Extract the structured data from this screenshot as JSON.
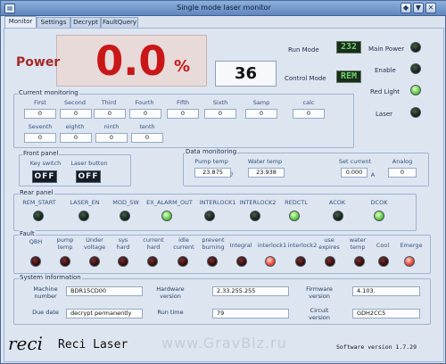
{
  "window": {
    "title": "Single mode laser monitor"
  },
  "tabs": [
    "Monitor",
    "Settings",
    "Decrypt",
    "FaultQuery"
  ],
  "power": {
    "label": "Power",
    "value": "0.0",
    "unit": "%"
  },
  "control": {
    "readout": "36",
    "run_mode_label": "Run Mode",
    "control_mode_label": "Control Mode",
    "run_mode_value": "232",
    "control_mode_value": "REM"
  },
  "status_leds": [
    {
      "label": "Main Power",
      "state": "off"
    },
    {
      "label": "Enable",
      "state": "off"
    },
    {
      "label": "Red Light",
      "state": "green"
    },
    {
      "label": "Laser",
      "state": "off"
    }
  ],
  "current_monitoring": {
    "title": "Current monitoring",
    "row1": [
      {
        "label": "First",
        "value": "0"
      },
      {
        "label": "Second",
        "value": "0"
      },
      {
        "label": "Third",
        "value": "0"
      },
      {
        "label": "Fourth",
        "value": "0"
      },
      {
        "label": "Fifth",
        "value": "0"
      },
      {
        "label": "Sixth",
        "value": "0"
      },
      {
        "label": "Samp",
        "value": "0"
      },
      {
        "label": "calc",
        "value": "0"
      }
    ],
    "row2": [
      {
        "label": "Seventh",
        "value": "0"
      },
      {
        "label": "eighth",
        "value": "0"
      },
      {
        "label": "ninth",
        "value": "0"
      },
      {
        "label": "tenth",
        "value": "0"
      }
    ]
  },
  "front_panel": {
    "title": "Front panel",
    "key_switch_label": "Key switch",
    "laser_button_label": "Laser button",
    "key_switch_value": "OFF",
    "laser_button_value": "OFF"
  },
  "data_monitoring": {
    "title": "Data monitoring",
    "pump_temp_label": "Pump temp",
    "pump_temp_value": "23.875",
    "separator": "?",
    "water_temp_label": "Water temp",
    "water_temp_value": "23.938",
    "set_current_label": "Set current",
    "set_current_value": "0.000",
    "set_current_unit": "A",
    "analog_label": "Analog",
    "analog_value": "0"
  },
  "rear_panel": {
    "title": "Rear panel",
    "items": [
      {
        "label": "REM_START",
        "state": "off"
      },
      {
        "label": "LASER_EN",
        "state": "off"
      },
      {
        "label": "MOD_SW",
        "state": "off"
      },
      {
        "label": "EX_ALARM_OUT",
        "state": "green"
      },
      {
        "label": "INTERLOCK1",
        "state": "off"
      },
      {
        "label": "INTERLOCK2",
        "state": "off"
      },
      {
        "label": "REDCTL",
        "state": "green"
      },
      {
        "label": "ACOK",
        "state": "off"
      },
      {
        "label": "DCOK",
        "state": "green"
      }
    ]
  },
  "fault": {
    "title": "Fault",
    "items": [
      {
        "label": "QBH",
        "state": "darkred"
      },
      {
        "label": "pump temp",
        "state": "darkred"
      },
      {
        "label": "Under voltage",
        "state": "darkred"
      },
      {
        "label": "sys hard",
        "state": "darkred"
      },
      {
        "label": "current hard",
        "state": "darkred"
      },
      {
        "label": "idle current",
        "state": "darkred"
      },
      {
        "label": "prevent burning",
        "state": "darkred"
      },
      {
        "label": "Integral",
        "state": "darkred"
      },
      {
        "label": "interlock1",
        "state": "red"
      },
      {
        "label": "interlock2",
        "state": "darkred"
      },
      {
        "label": "use expires",
        "state": "darkred"
      },
      {
        "label": "water temp",
        "state": "darkred"
      },
      {
        "label": "Cool",
        "state": "darkred"
      },
      {
        "label": "Emerge",
        "state": "red"
      }
    ]
  },
  "system_information": {
    "title": "System information",
    "machine_number_label": "Machine number",
    "machine_number_value": "BDR15CD00",
    "hardware_version_label": "Hardware version",
    "hardware_version_value": "2.33.255.255",
    "firmware_version_label": "Firmware version",
    "firmware_version_value": "4.103.",
    "due_date_label": "Due date",
    "due_date_value": "decrypt permanently",
    "run_time_label": "Run time",
    "run_time_value": "79",
    "circuit_version_label": "Circuit version",
    "circuit_version_value": "GDH2CC5"
  },
  "footer": {
    "logo_script": "reci",
    "logo_text": "Reci Laser",
    "watermark": "www.GravBiz.ru",
    "software_version": "Software version 1.7.29"
  }
}
